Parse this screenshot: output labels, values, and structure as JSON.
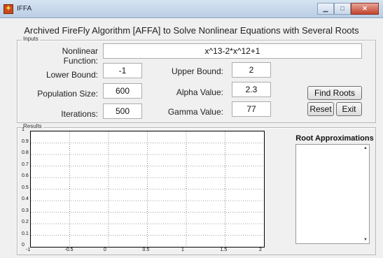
{
  "window": {
    "title": "IFFA"
  },
  "main_title": "Archived FireFly Algorithm [AFFA] to Solve Nonlinear Equations with Several Roots",
  "inputs": {
    "panel_title": "Inputs",
    "nonlinear_function_label": "Nonlinear Function:",
    "nonlinear_function_value": "x^13-2*x^12+1",
    "lower_bound_label": "Lower Bound:",
    "lower_bound_value": "-1",
    "upper_bound_label": "Upper Bound:",
    "upper_bound_value": "2",
    "population_size_label": "Population Size:",
    "population_size_value": "600",
    "alpha_value_label": "Alpha Value:",
    "alpha_value_value": "2.3",
    "iterations_label": "Iterations:",
    "iterations_value": "500",
    "gamma_value_label": "Gamma Value:",
    "gamma_value_value": "77",
    "find_roots_label": "Find Roots",
    "reset_label": "Reset",
    "exit_label": "Exit"
  },
  "results": {
    "panel_title": "Results",
    "root_approximations_title": "Root Approximations"
  },
  "chart_data": {
    "type": "scatter",
    "title": "",
    "xlabel": "",
    "ylabel": "",
    "xlim": [
      -1,
      2
    ],
    "ylim": [
      0,
      1
    ],
    "x_ticks": [
      "-1",
      "-0.5",
      "0",
      "0.5",
      "1",
      "1.5",
      "2"
    ],
    "y_ticks": [
      "0",
      "0.1",
      "0.2",
      "0.3",
      "0.4",
      "0.5",
      "0.6",
      "0.7",
      "0.8",
      "0.9",
      "1"
    ],
    "grid": true,
    "series": []
  }
}
